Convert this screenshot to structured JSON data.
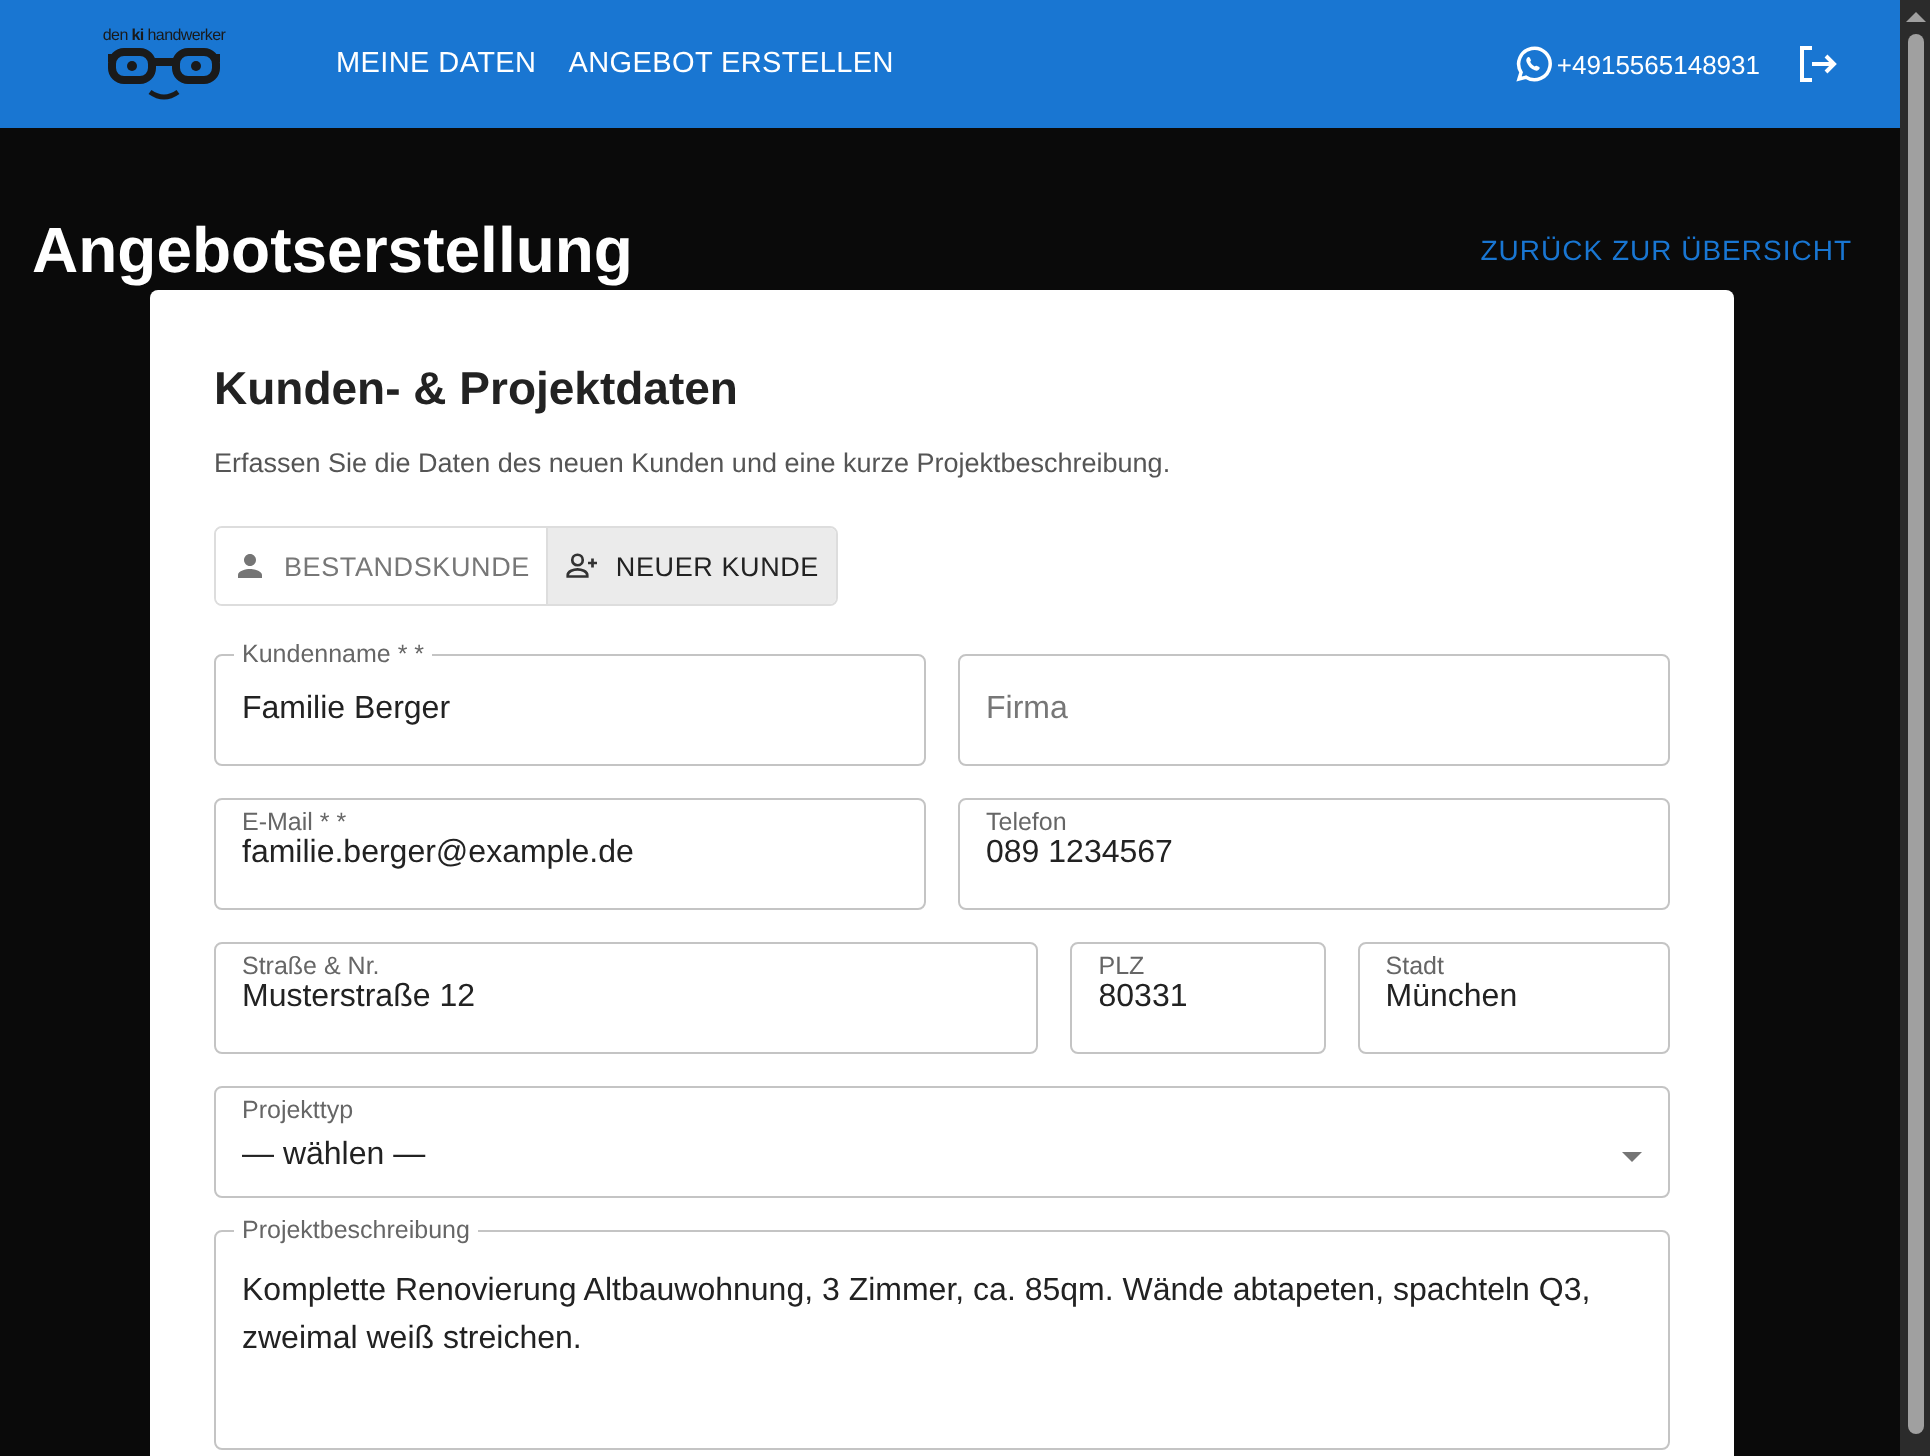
{
  "header": {
    "logo_text": "den **ki** handwerker",
    "nav": [
      {
        "label": "MEINE DATEN"
      },
      {
        "label": "ANGEBOT ERSTELLEN"
      }
    ],
    "phone": "+4915565148931"
  },
  "page": {
    "title": "Angebotserstellung",
    "back_link": "ZURÜCK ZUR ÜBERSICHT"
  },
  "card": {
    "title": "Kunden- & Projektdaten",
    "subtitle": "Erfassen Sie die Daten des neuen Kunden und eine kurze Projektbeschreibung.",
    "customer_toggle": [
      {
        "label": "BESTANDSKUNDE",
        "selected": false
      },
      {
        "label": "NEUER KUNDE",
        "selected": true
      }
    ],
    "rows": [
      [
        {
          "kind": "outlined",
          "label": "Kundenname * *",
          "value": "Familie Berger"
        },
        {
          "kind": "placeholder",
          "placeholder": "Firma"
        }
      ],
      [
        {
          "kind": "inset",
          "label": "E-Mail * *",
          "value": "familie.berger@example.de"
        },
        {
          "kind": "inset",
          "label": "Telefon",
          "value": "089 1234567"
        }
      ],
      [
        {
          "kind": "inset",
          "label": "Straße & Nr.",
          "value": "Musterstraße 12"
        },
        {
          "kind": "inset",
          "label": "PLZ",
          "value": "80331"
        },
        {
          "kind": "inset",
          "label": "Stadt",
          "value": "München"
        }
      ],
      [
        {
          "kind": "select",
          "label": "Projekttyp",
          "value": "— wählen —"
        }
      ],
      [
        {
          "kind": "textarea",
          "label": "Projektbeschreibung",
          "value": "Komplette Renovierung Altbauwohnung, 3 Zimmer, ca. 85qm. Wände abtapeten, spachteln Q3, zweimal weiß streichen."
        }
      ]
    ]
  }
}
